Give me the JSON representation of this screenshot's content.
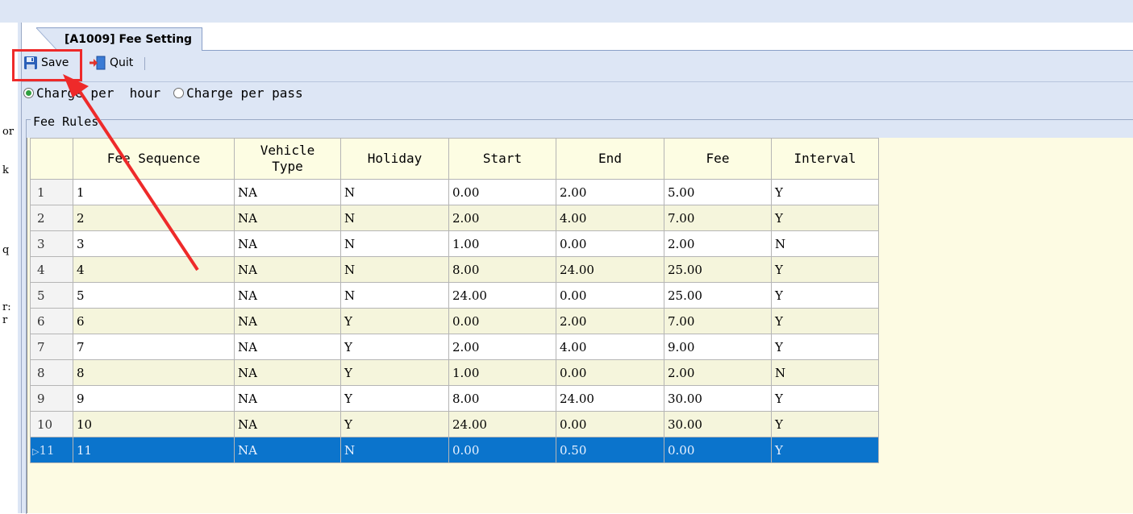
{
  "window": {
    "corner_glyph": "I"
  },
  "left_strip": {
    "fragments": [
      "or",
      "k",
      "q",
      "r:",
      "r"
    ]
  },
  "tab": {
    "label": "[A1009] Fee Setting"
  },
  "toolbar": {
    "save_label": "Save",
    "quit_label": "Quit"
  },
  "options": {
    "hour_label": "Charge per  hour",
    "pass_label": "Charge per pass",
    "selected": "hour"
  },
  "group": {
    "label": "Fee Rules"
  },
  "grid": {
    "headers": [
      "",
      "Fee Sequence",
      "Vehicle Type",
      "Holiday",
      "Start",
      "End",
      "Fee",
      "Interval"
    ],
    "rows": [
      [
        "1",
        "1",
        "NA",
        "N",
        "0.00",
        "2.00",
        "5.00",
        "Y"
      ],
      [
        "2",
        "2",
        "NA",
        "N",
        "2.00",
        "4.00",
        "7.00",
        "Y"
      ],
      [
        "3",
        "3",
        "NA",
        "N",
        "1.00",
        "0.00",
        "2.00",
        "N"
      ],
      [
        "4",
        "4",
        "NA",
        "N",
        "8.00",
        "24.00",
        "25.00",
        "Y"
      ],
      [
        "5",
        "5",
        "NA",
        "N",
        "24.00",
        "0.00",
        "25.00",
        "Y"
      ],
      [
        "6",
        "6",
        "NA",
        "Y",
        "0.00",
        "2.00",
        "7.00",
        "Y"
      ],
      [
        "7",
        "7",
        "NA",
        "Y",
        "2.00",
        "4.00",
        "9.00",
        "Y"
      ],
      [
        "8",
        "8",
        "NA",
        "Y",
        "1.00",
        "0.00",
        "2.00",
        "N"
      ],
      [
        "9",
        "9",
        "NA",
        "Y",
        "8.00",
        "24.00",
        "30.00",
        "Y"
      ],
      [
        "10",
        "10",
        "NA",
        "Y",
        "24.00",
        "0.00",
        "30.00",
        "Y"
      ],
      [
        "11",
        "11",
        "NA",
        "N",
        "0.00",
        "0.50",
        "0.00",
        "Y"
      ]
    ],
    "selected_row": 11
  },
  "colors": {
    "panel": "#dde6f5",
    "grid_background": "#fdfbe3",
    "selection": "#0b74cc",
    "annotation": "#ee2a2a"
  },
  "icons": {
    "save": "floppy-disk-icon",
    "quit": "exit-door-icon",
    "current_row": "row-pointer-icon"
  }
}
